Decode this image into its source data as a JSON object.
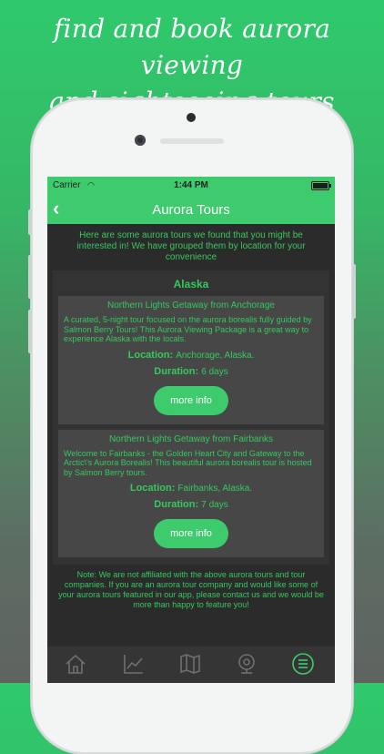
{
  "promo": {
    "line1": "find and book aurora viewing",
    "line2": "and sightseeing tours"
  },
  "status_bar": {
    "carrier": "Carrier",
    "time": "1:44 PM"
  },
  "nav": {
    "title": "Aurora Tours",
    "back_icon": "chevron-left-icon"
  },
  "intro_text": "Here are some aurora tours we found that you might be interested in! We have grouped them by location for your convenience",
  "groups": [
    {
      "name": "Alaska",
      "tours": [
        {
          "title": "Northern Lights Getaway from Anchorage",
          "description": "A curated, 5-night tour focused on the aurora borealis fully guided by Salmon Berry Tours! This Aurora Viewing Package is a great way to experience Alaska with the locals.",
          "location_label": "Location:",
          "location": "Anchorage, Alaska.",
          "duration_label": "Duration:",
          "duration": "6 days",
          "button_label": "more info"
        },
        {
          "title": "Northern Lights Getaway from Fairbanks",
          "description": "Welcome to Fairbanks - the Golden Heart City and Gateway to the Arctic\\'s Aurora Borealis! This beautiful aurora borealis tour is hosted by Salmon Berry tours.",
          "location_label": "Location:",
          "location": "Fairbanks, Alaska.",
          "duration_label": "Duration:",
          "duration": "7 days",
          "button_label": "more info"
        }
      ]
    }
  ],
  "note": "Note: We are not affiliated with the above aurora tours and tour companies. If you are an aurora tour company and would like some of your aurora tours featured in our app, please contact us and we would be more than happy to feature you!",
  "tab_bar": {
    "items": [
      {
        "icon": "home-icon"
      },
      {
        "icon": "chart-icon"
      },
      {
        "icon": "map-icon"
      },
      {
        "icon": "webcam-icon"
      },
      {
        "icon": "menu-icon",
        "active": true
      }
    ]
  },
  "colors": {
    "accent": "#3ecb6e",
    "text_green": "#36c85e",
    "screen_bg": "#2b2b2b"
  }
}
